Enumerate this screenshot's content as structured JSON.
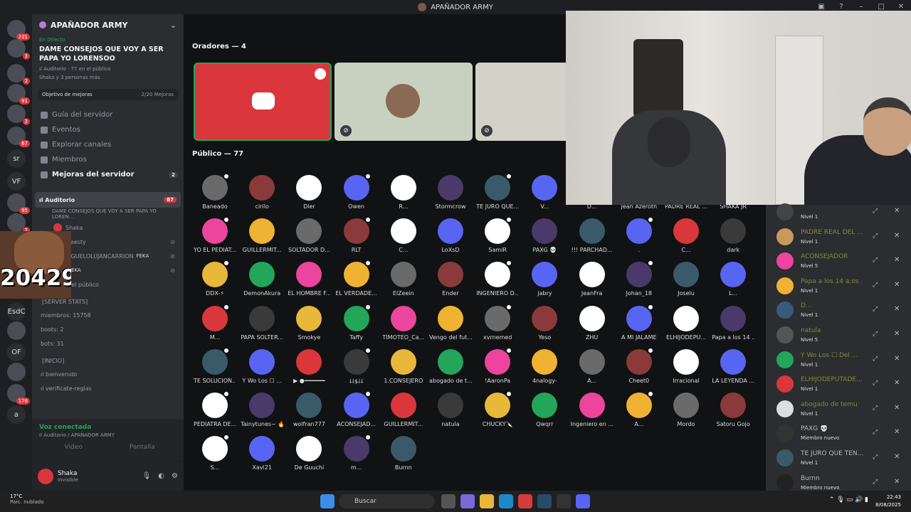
{
  "window": {
    "title": "APAÑADOR ARMY"
  },
  "servers": [
    {
      "label": "",
      "badge": "231"
    },
    {
      "label": "",
      "badge": "3"
    },
    {
      "label": "",
      "badge": "2"
    },
    {
      "label": "",
      "badge": "91"
    },
    {
      "label": "",
      "badge": "2"
    },
    {
      "label": "",
      "badge": "67"
    },
    {
      "label": "sr",
      "badge": ""
    },
    {
      "label": "VF",
      "badge": ""
    },
    {
      "label": "",
      "badge": "95"
    },
    {
      "label": "",
      "badge": "2"
    },
    {
      "label": "",
      "badge": ""
    },
    {
      "label": "",
      "badge": ""
    },
    {
      "label": "EsdC",
      "badge": ""
    },
    {
      "label": "",
      "badge": ""
    },
    {
      "label": "OF",
      "badge": ""
    },
    {
      "label": "",
      "badge": ""
    },
    {
      "label": "",
      "badge": "176"
    },
    {
      "label": "a",
      "badge": ""
    }
  ],
  "guild": {
    "name": "APAÑADOR ARMY"
  },
  "stage": {
    "live": "En Directo",
    "title": "DAME CONSEJOS QUE VOY A SER PAPA YO LORENSOO",
    "sub": "ıl Auditorio · 77 en el público",
    "sub2": "Shaka y 3 personas más"
  },
  "boost": {
    "label": "Objetivo de mejoras",
    "count": "2/20 Mejoras"
  },
  "nav": [
    {
      "label": "Guía del servidor",
      "count": ""
    },
    {
      "label": "Eventos",
      "count": ""
    },
    {
      "label": "Explorar canales",
      "count": ""
    },
    {
      "label": "Miembros",
      "count": ""
    },
    {
      "label": "Mejoras del servidor",
      "count": "2"
    }
  ],
  "voice": {
    "channel": "ıl Auditorio",
    "count": "67",
    "topic": "DAME CONSEJOS QUE VOY A SER PAPA YO LOREN...",
    "members": [
      {
        "name": "Shaka",
        "tag": ""
      },
      {
        "name": "Meesty",
        "tag": ""
      },
      {
        "name": "JAGUELOLUJANCARRION",
        "tag": "FEKA"
      },
      {
        "name": "",
        "tag": "FEKA"
      }
    ],
    "audience": "77 en el público"
  },
  "stats": {
    "category": "[SERVER STATS]",
    "items": [
      "miembros: 15758",
      "boots: 2",
      "bots: 31"
    ]
  },
  "inicio": {
    "category": "[inicio]",
    "items": [
      "ıl bıenvenıdo",
      "ıl verificate-reglas"
    ]
  },
  "connection": {
    "status": "Voz conectada",
    "path": "ıl Auditorio / APAÑADOR ARMY",
    "video": "Video",
    "screen": "Pantalla"
  },
  "user": {
    "name": "Shaka",
    "status": "invisible"
  },
  "speakers_header": "Oradores — 4",
  "public_header": "Público — 77",
  "audience": [
    [
      "Baneado",
      "cirilo",
      "Dier",
      "Owen",
      "R...",
      "Stormcrow",
      "TE JURO QUE...",
      "V...",
      "D...",
      "Jean Azeroth",
      "PADRE REAL ...",
      "SHAKA JR"
    ],
    [
      "YO EL PEDIAT...",
      "GUILLERMIT...",
      "SOLTADOR D...",
      "RLT",
      "C...",
      "LoXsD",
      "SamiR",
      "PAXG 💀",
      "!!! PARCHAD...",
      ".",
      "C...",
      "dark"
    ],
    [
      "DDX-⚡",
      "DemonAkura",
      "EL HOMBRE F...",
      "EL VERDADE...",
      "ElZeein",
      "Ender",
      "INGENIERO D...",
      "jabry",
      "JeanFra",
      "Johan_18",
      "Joselu",
      "L..."
    ],
    [
      "M...",
      "PAPA SOLTER...",
      "Smokye",
      "Taffy",
      "TIMOTEO_Ca...",
      "Vengo del fut...",
      "xvrnemed",
      "Yeso",
      "ZHU",
      "A MI JALAME",
      "ELHIJODEPU...",
      "Papa a los 14 ..."
    ],
    [
      "TE SOLUCION...",
      "Y Wo Los ☐ ...",
      "▶ ●━━━━━━",
      "⸸⸸$⸸⸸",
      "1.CONSEJERO",
      "abogado de t...",
      "!AaronPa",
      "4nalogy-",
      "A...",
      "Cheet0",
      "Irracional",
      "LA LEYENDA ..."
    ],
    [
      "PEDIATRA DE...",
      "Tainytunes~ 🔥",
      "wolfran777",
      "ACONSEJAD...",
      "GUILLERMIT...",
      "natula",
      "CHUCKY🔪",
      "Qwqrr",
      "Ingeniero en ...",
      "A...",
      "Mordo",
      "Satoru Gojo"
    ],
    [
      "S...",
      "Xavi21",
      "De Guuchi",
      "m...",
      "Burnn"
    ]
  ],
  "right_list": [
    {
      "name": "",
      "level": "Nivel 1"
    },
    {
      "name": "PADRE REAL DEL ...",
      "level": "Nivel 1"
    },
    {
      "name": "ACONSEJADOR",
      "level": "Nivel 5"
    },
    {
      "name": "Papa a los 14 a;os",
      "level": "Nivel 1"
    },
    {
      "name": "D...",
      "level": "Nivel 1"
    },
    {
      "name": "natula",
      "level": "Nivel 5"
    },
    {
      "name": "Y Wo Los ☐ Del ...",
      "level": "Nivel 1"
    },
    {
      "name": "ELHIJODEPUTADE...",
      "level": "Nivel 1"
    },
    {
      "name": "abogado de temu",
      "level": "Nivel 1"
    },
    {
      "name": "PAXG 💀",
      "level": "Miembro nuevo"
    },
    {
      "name": "TE JURO QUE TEN...",
      "level": "Nivel 1"
    },
    {
      "name": "Burnn",
      "level": "Miembro nuevo"
    }
  ],
  "overlay": {
    "counter": "20429"
  },
  "taskbar": {
    "temp": "17°C",
    "weather": "Parc. nublado",
    "search": "Buscar",
    "time": "22:43",
    "date": "8/08/2025"
  },
  "colors": {
    "accent": "#5865f2",
    "red": "#da373c",
    "green": "#23a55a",
    "bg": "#111214"
  }
}
